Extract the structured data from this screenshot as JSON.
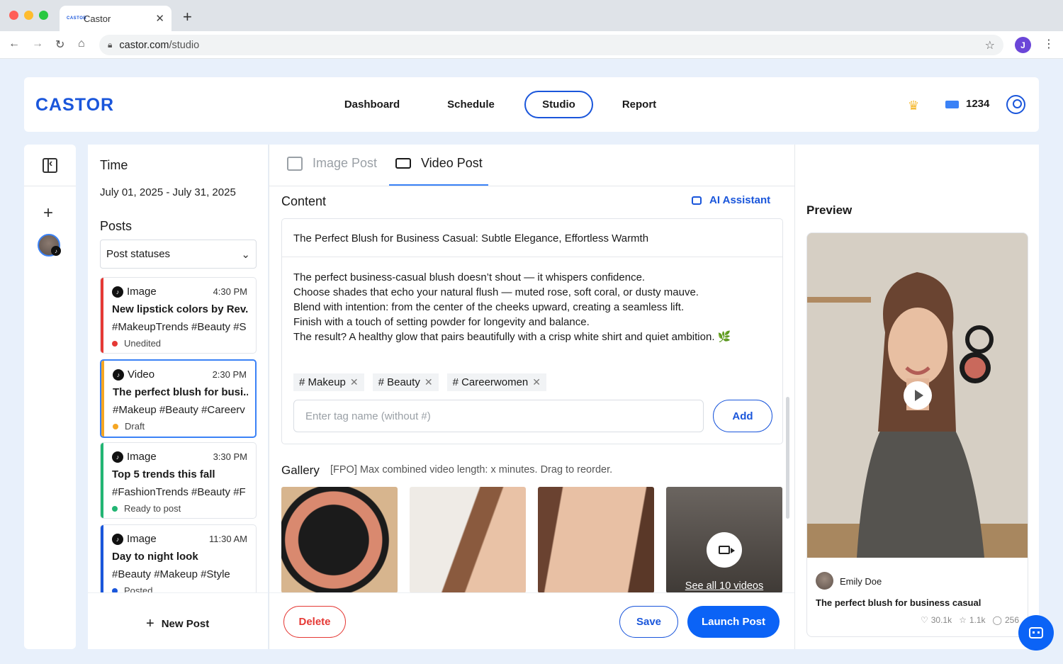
{
  "browser": {
    "tab_title": "Castor",
    "favicon_text": "CASTOR",
    "url_domain": "castor.com",
    "url_path": "/studio",
    "profile_initial": "J"
  },
  "header": {
    "logo": "CASTOR",
    "nav": [
      "Dashboard",
      "Schedule",
      "Studio",
      "Report"
    ],
    "active_nav": "Studio",
    "credits": "1234",
    "icons": [
      "crown-icon",
      "credit-icon",
      "user-icon"
    ]
  },
  "posts_panel": {
    "time_label": "Time",
    "date_range": "July 01, 2025 - July 31, 2025",
    "posts_label": "Posts",
    "status_filter": "Post statuses",
    "posts": [
      {
        "type": "Image",
        "time": "4:30 PM",
        "title": "New lipstick colors by Rev...",
        "tags": "#MakeupTrends #Beauty #S",
        "status": "Unedited",
        "color": "#e53935"
      },
      {
        "type": "Video",
        "time": "2:30 PM",
        "title": "The perfect blush for busi...",
        "tags": "#Makeup #Beauty #Careerv",
        "status": "Draft",
        "color": "#f5a623"
      },
      {
        "type": "Image",
        "time": "3:30 PM",
        "title": "Top 5 trends this fall",
        "tags": "#FashionTrends #Beauty #F",
        "status": "Ready to post",
        "color": "#22b573"
      },
      {
        "type": "Image",
        "time": "11:30 AM",
        "title": "Day to night look",
        "tags": "#Beauty #Makeup #Style",
        "status": "Posted",
        "color": "#1a56db"
      }
    ],
    "new_post": "New Post"
  },
  "editor": {
    "tabs": [
      "Image Post",
      "Video Post"
    ],
    "active_tab": "Video Post",
    "content_label": "Content",
    "ai_assistant": "AI Assistant",
    "post_title": "The Perfect Blush for Business Casual: Subtle Elegance, Effortless Warmth",
    "post_body": "The perfect business-casual blush doesn’t shout — it whispers confidence.\n Choose shades that echo your natural flush — muted rose, soft coral, or dusty mauve.\n Blend with intention: from the center of the cheeks upward, creating a seamless lift.\n Finish with a touch of setting powder for longevity and balance.\nThe result? A healthy glow that pairs beautifully with a crisp white shirt and quiet ambition. 🌿",
    "tags": [
      "# Makeup",
      "# Beauty",
      "# Careerwomen"
    ],
    "tag_placeholder": "Enter tag name (without #)",
    "add_label": "Add",
    "gallery_label": "Gallery",
    "gallery_note": "[FPO] Max combined video length: x minutes. Drag to reorder.",
    "see_all": "See all 10 videos",
    "delete_label": "Delete",
    "save_label": "Save",
    "launch_label": "Launch Post"
  },
  "preview": {
    "label": "Preview",
    "author": "Emily Doe",
    "title": "The perfect blush for business casual",
    "likes": "30.1k",
    "favorites": "1.1k",
    "comments": "256"
  }
}
